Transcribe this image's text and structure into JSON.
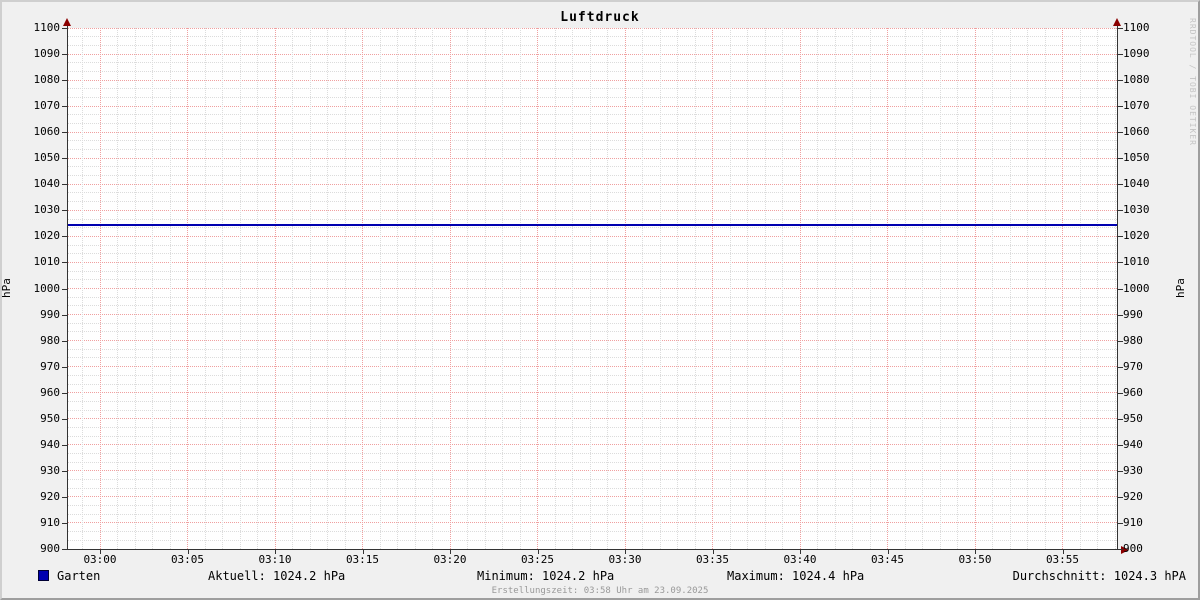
{
  "title": "Luftdruck",
  "watermark": "RRDTOOL / TOBI OETIKER",
  "footer": "Erstellungszeit: 03:58 Uhr am 23.09.2025",
  "axis": {
    "left_label": "hPa",
    "right_label": "hPa"
  },
  "legend": {
    "series_label": "Garten",
    "aktuell": "Aktuell: 1024.2 hPa",
    "minimum": "Minimum: 1024.2 hPa",
    "maximum": "Maximum: 1024.4 hPa",
    "durchschnitt": "Durchschnitt: 1024.3 hPA"
  },
  "chart_data": {
    "type": "line",
    "title": "Luftdruck",
    "ylabel": "hPa",
    "ylabel_right": "hPa",
    "ylim": [
      900,
      1100
    ],
    "y_major_step": 10,
    "y_minor_divisions": 3,
    "x_tick_labels": [
      "03:00",
      "03:05",
      "03:10",
      "03:15",
      "03:20",
      "03:25",
      "03:30",
      "03:35",
      "03:40",
      "03:45",
      "03:50",
      "03:55"
    ],
    "x_minor_per_major": 5,
    "grid_on": true,
    "legend_position": "bottom",
    "grid": {
      "major_color": "#f0a0a0",
      "minor_color": "#dcdcdc",
      "axis_color": "#333333",
      "arrow_color": "#8b0000",
      "canvas_color": "#ffffff",
      "background_color": "#f0f0f0"
    },
    "series": [
      {
        "name": "Garten",
        "color": "#0000b0",
        "x": [
          "03:00",
          "03:05",
          "03:10",
          "03:15",
          "03:20",
          "03:25",
          "03:30",
          "03:35",
          "03:40",
          "03:45",
          "03:50",
          "03:55"
        ],
        "values": [
          1024.3,
          1024.3,
          1024.3,
          1024.3,
          1024.3,
          1024.3,
          1024.3,
          1024.3,
          1024.3,
          1024.3,
          1024.3,
          1024.3
        ]
      }
    ],
    "stats": {
      "current_hpa": 1024.2,
      "minimum_hpa": 1024.2,
      "maximum_hpa": 1024.4,
      "average_hpa": 1024.3
    }
  }
}
